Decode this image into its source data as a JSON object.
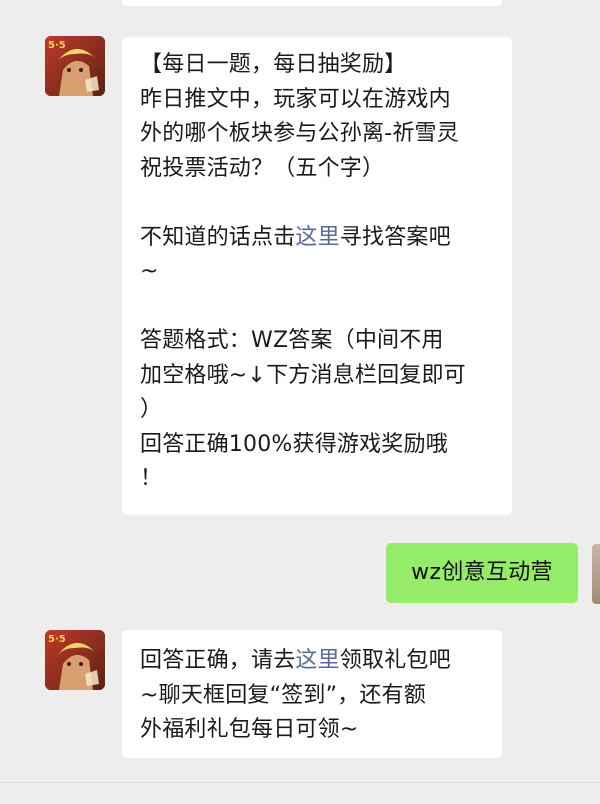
{
  "conversation": {
    "messages": [
      {
        "sender": "official-account",
        "lines": [
          "【每日一题，每日抽奖励】",
          "昨日推文中，玩家可以在游戏内",
          "外的哪个板块参与公孙离-祈雪灵",
          "祝投票活动？（五个字）",
          "",
          "不知道的话点击",
          "这里",
          "寻找答案吧",
          "~",
          "",
          "答题格式：WZ答案（中间不用",
          "加空格哦~↓下方消息栏回复即可",
          "）",
          "回答正确100%获得游戏奖励哦",
          "！"
        ]
      },
      {
        "sender": "user",
        "text": "wz创意互动营"
      },
      {
        "sender": "official-account",
        "line1_before": "回答正确，请去",
        "line1_link": "这里",
        "line1_after": "领取礼包吧",
        "line2": "~聊天框回复“签到”，还有额",
        "line3": "外福利礼包每日可领~"
      }
    ]
  },
  "colors": {
    "background": "#ededed",
    "incoming_bubble": "#ffffff",
    "outgoing_bubble": "#95ec69",
    "link": "#576b95"
  },
  "icons": {
    "official_avatar": "hero-avatar-icon"
  }
}
